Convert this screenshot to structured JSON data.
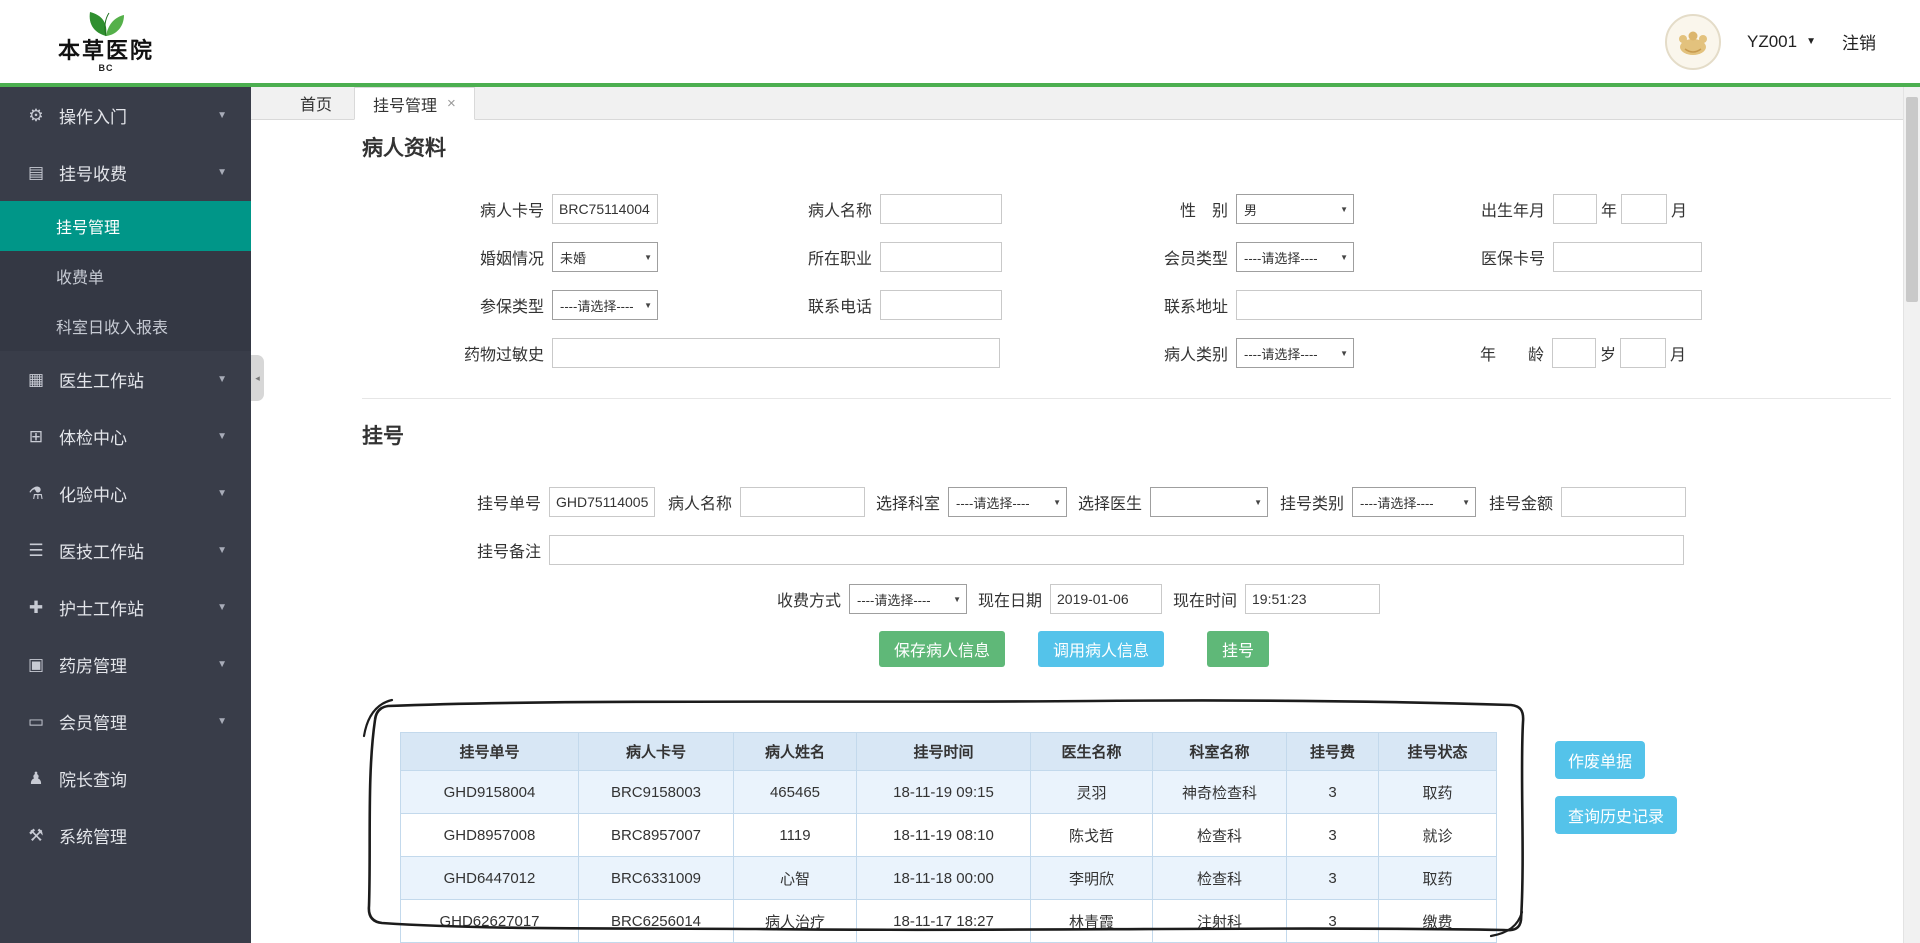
{
  "header": {
    "hospital_name": "本草医院",
    "hospital_abbr": "BC",
    "username": "YZ001",
    "logout_label": "注销"
  },
  "icons": {
    "gear": "⚙",
    "register": "▤",
    "doctor": "▦",
    "checkup": "⊞",
    "lab": "⚗",
    "medtech": "☰",
    "nurse": "✚",
    "pharmacy": "▣",
    "member": "▭",
    "director": "♟",
    "system": "⚒",
    "caret_down": "▼",
    "close": "×",
    "collapse": "◂"
  },
  "sidebar": {
    "items": [
      {
        "label": "操作入门"
      },
      {
        "label": "挂号收费"
      },
      {
        "label": "医生工作站"
      },
      {
        "label": "体检中心"
      },
      {
        "label": "化验中心"
      },
      {
        "label": "医技工作站"
      },
      {
        "label": "护士工作站"
      },
      {
        "label": "药房管理"
      },
      {
        "label": "会员管理"
      },
      {
        "label": "院长查询"
      },
      {
        "label": "系统管理"
      }
    ],
    "submenu": [
      {
        "label": "挂号管理"
      },
      {
        "label": "收费单"
      },
      {
        "label": "科室日收入报表"
      }
    ]
  },
  "tabs": {
    "home": "首页",
    "current": "挂号管理"
  },
  "patient": {
    "title": "病人资料",
    "card_label": "病人卡号",
    "card_value": "BRC75114004",
    "name_label": "病人名称",
    "name_value": "",
    "gender_label": "性　别",
    "gender_value": "男",
    "birth_label": "出生年月",
    "year_suffix": "年",
    "month_suffix": "月",
    "marital_label": "婚姻情况",
    "marital_value": "未婚",
    "job_label": "所在职业",
    "job_value": "",
    "member_label": "会员类型",
    "member_value": "----请选择----",
    "insurance_card_label": "医保卡号",
    "insurance_card_value": "",
    "insurance_type_label": "参保类型",
    "insurance_type_value": "----请选择----",
    "phone_label": "联系电话",
    "phone_value": "",
    "address_label": "联系地址",
    "address_value": "",
    "allergy_label": "药物过敏史",
    "allergy_value": "",
    "category_label": "病人类别",
    "category_value": "----请选择----",
    "age_label": "年　　龄",
    "age_year_suffix": "岁",
    "age_month_suffix": "月"
  },
  "registration": {
    "title": "挂号",
    "regno_label": "挂号单号",
    "regno_value": "GHD75114005",
    "pname_label": "病人名称",
    "pname_value": "",
    "dept_label": "选择科室",
    "dept_value": "----请选择----",
    "doctor_label": "选择医生",
    "doctor_value": "",
    "type_label": "挂号类别",
    "type_value": "----请选择----",
    "fee_label": "挂号金额",
    "fee_value": "",
    "remark_label": "挂号备注",
    "remark_value": "",
    "pay_label": "收费方式",
    "pay_value": "----请选择----",
    "date_label": "现在日期",
    "date_value": "2019-01-06",
    "time_label": "现在时间",
    "time_value": "19:51:23",
    "save_button": "保存病人信息",
    "load_button": "调用病人信息",
    "register_button": "挂号"
  },
  "records": {
    "headers": [
      "挂号单号",
      "病人卡号",
      "病人姓名",
      "挂号时间",
      "医生名称",
      "科室名称",
      "挂号费",
      "挂号状态"
    ],
    "rows": [
      [
        "GHD9158004",
        "BRC9158003",
        "465465",
        "18-11-19 09:15",
        "灵羽",
        "神奇检查科",
        "3",
        "取药"
      ],
      [
        "GHD8957008",
        "BRC8957007",
        "1119",
        "18-11-19 08:10",
        "陈戈哲",
        "检查科",
        "3",
        "就诊"
      ],
      [
        "GHD6447012",
        "BRC6331009",
        "心智",
        "18-11-18 00:00",
        "李明欣",
        "检查科",
        "3",
        "取药"
      ],
      [
        "GHD62627017",
        "BRC6256014",
        "病人治疗",
        "18-11-17 18:27",
        "林青霞",
        "注射科",
        "3",
        "缴费"
      ]
    ],
    "void_button": "作废单据",
    "history_button": "查询历史记录"
  },
  "colors": {
    "accent_green": "#4CAF50",
    "button_green": "#5FB878",
    "active_teal": "#009688",
    "button_blue": "#54c3ea"
  }
}
